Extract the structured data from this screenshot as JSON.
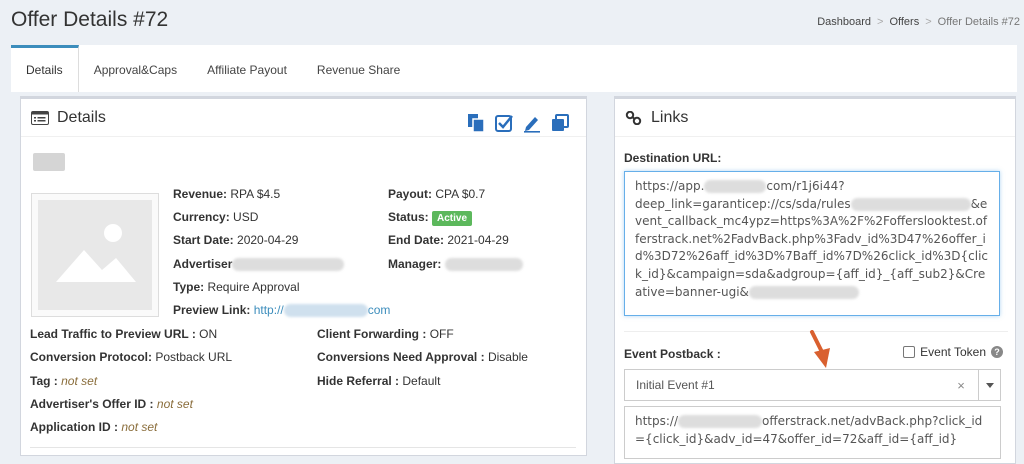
{
  "page": {
    "title": "Offer Details #72"
  },
  "breadcrumb": [
    "Dashboard",
    "Offers",
    "Offer Details #72"
  ],
  "tabs": [
    "Details",
    "Approval&Caps",
    "Affiliate Payout",
    "Revenue Share"
  ],
  "details": {
    "heading": "Details",
    "revenue_label": "Revenue:",
    "revenue": "RPA $4.5",
    "payout_label": "Payout:",
    "payout": "CPA $0.7",
    "currency_label": "Currency:",
    "currency": "USD",
    "status_label": "Status:",
    "status": "Active",
    "start_label": "Start Date:",
    "start": "2020-04-29",
    "end_label": "End Date:",
    "end": "2021-04-29",
    "advertiser_label": "Advertiser",
    "manager_label": "Manager:",
    "type_label": "Type:",
    "type": "Require Approval",
    "preview_label": "Preview Link:",
    "preview_prefix": "http://",
    "preview_suffix": "com",
    "lead_label": "Lead Traffic to Preview URL :",
    "lead": "ON",
    "client_label": "Client Forwarding :",
    "client": "OFF",
    "conv_label": "Conversion Protocol:",
    "conv": "Postback URL",
    "approval_label": "Conversions Need Approval :",
    "approval": "Disable",
    "tag_label": "Tag :",
    "tag": "not set",
    "referral_label": "Hide Referral :",
    "referral": "Default",
    "adv_offer_label": "Advertiser's Offer ID :",
    "adv_offer": "not set",
    "app_label": "Application ID :",
    "app": "not set"
  },
  "links": {
    "heading": "Links",
    "dest_label": "Destination URL:",
    "dest_1": "https://app.",
    "dest_2": "com/r1j6i44?",
    "dest_3": "deep_link=garanticep://cs/sda/rules",
    "dest_4": "&event",
    "dest_5": "_callback_mc4ypz=https%3A%2F%2Fofferslooktest.offerstrack.net%2FadvBack.php%3Fadv_id%3D47%26offer_id%3D72%26aff_id%3D%7Baff_id%7D%26click_id%3D{click_id}&campaign=sda&adgroup={aff_id}_{aff_sub2}&Creative=banner-ugi&",
    "postback_label": "Event Postback :",
    "event_token": "Event Token",
    "select_value": "Initial Event #1",
    "clear": "×",
    "pb_1": "https://",
    "pb_2": "offerstrack.net/advBack.php?click_id={click_id}&adv_id=47&offer_id=72&aff_id={aff_id}"
  },
  "colors": {
    "accent": "#3c8dbc",
    "status_active": "#5cb85c",
    "arrow": "#d9602f"
  }
}
